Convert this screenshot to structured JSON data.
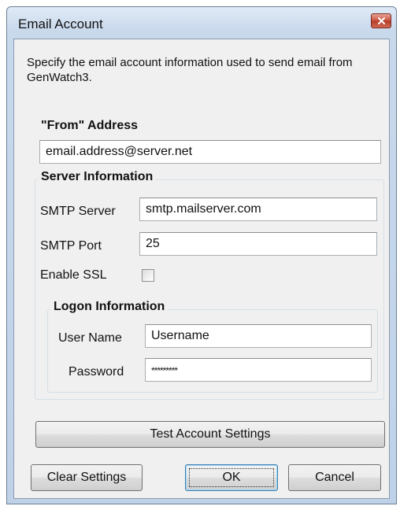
{
  "window": {
    "title": "Email Account"
  },
  "intro": "Specify the email account information used to send email from GenWatch3.",
  "from": {
    "heading": "\"From\" Address",
    "value": "email.address@server.net"
  },
  "server": {
    "title": "Server Information",
    "smtp_server_label": "SMTP Server",
    "smtp_server_value": "smtp.mailserver.com",
    "smtp_port_label": "SMTP Port",
    "smtp_port_value": "25",
    "ssl_label": "Enable SSL",
    "ssl_checked": false
  },
  "logon": {
    "title": "Logon Information",
    "username_label": "User Name",
    "username_value": "Username",
    "password_label": "Password",
    "password_value": "*********"
  },
  "buttons": {
    "test": "Test Account Settings",
    "clear": "Clear Settings",
    "ok": "OK",
    "cancel": "Cancel"
  },
  "icons": {
    "close": "close-icon"
  }
}
